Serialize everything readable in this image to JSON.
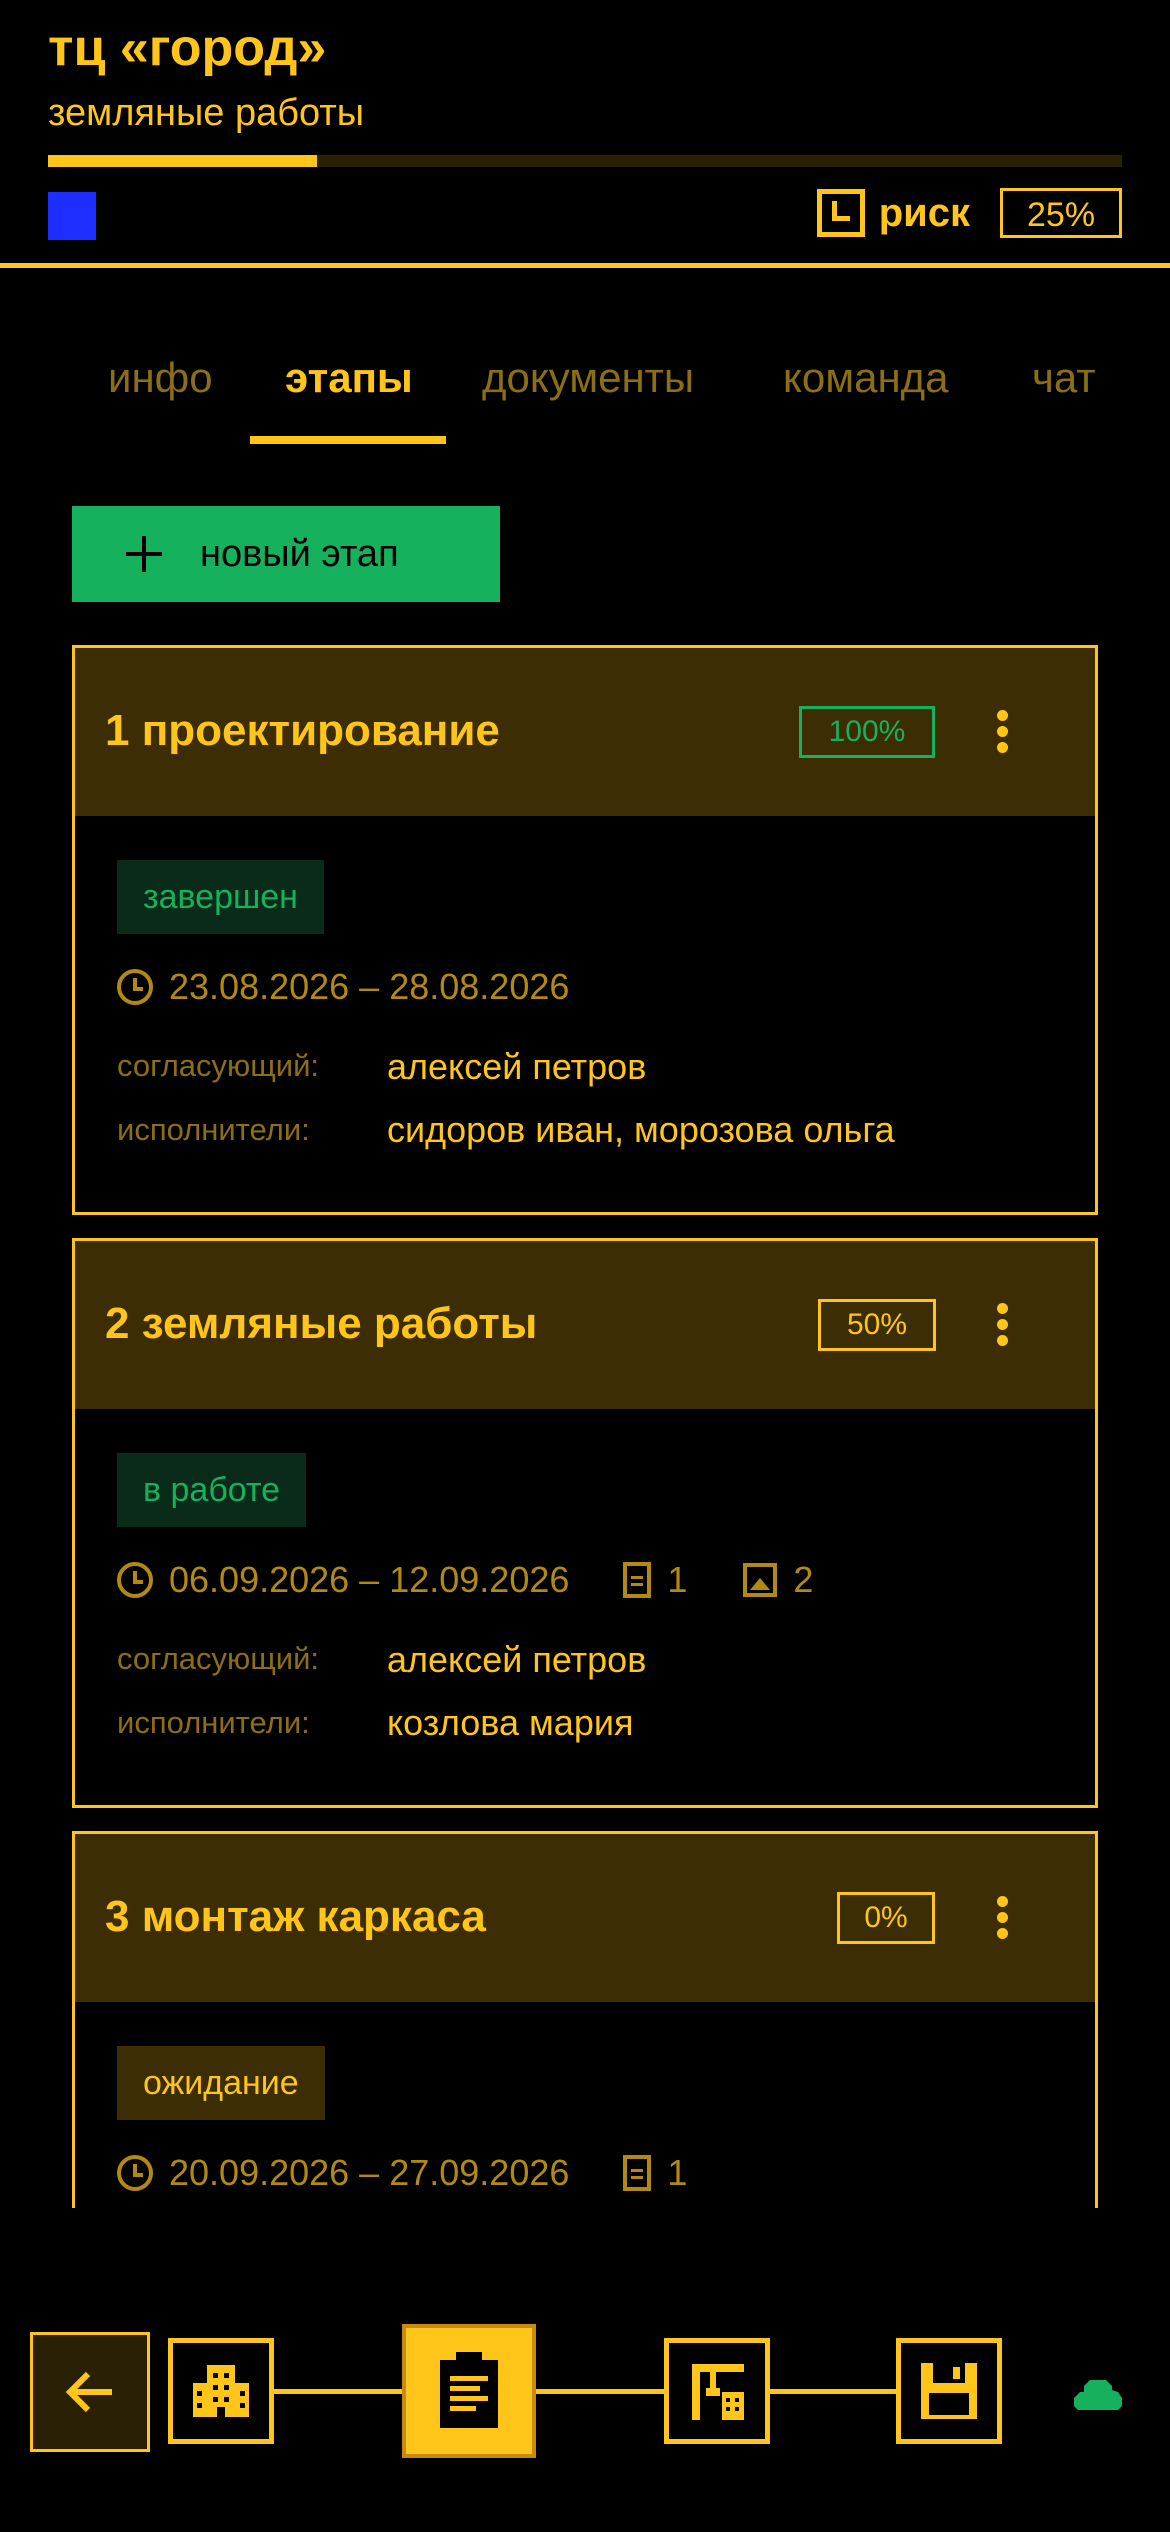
{
  "project": {
    "title": "тц «город»",
    "subtitle": "земляные работы",
    "progress": 0.25,
    "risk_label": "риск",
    "risk_value": "25%"
  },
  "tabs": [
    {
      "label": "инфо",
      "active": false
    },
    {
      "label": "этапы",
      "active": true
    },
    {
      "label": "документы",
      "active": false
    },
    {
      "label": "команда",
      "active": false
    },
    {
      "label": "чат",
      "active": false
    }
  ],
  "new_stage_label": "новый этап",
  "stages": [
    {
      "title": "1 проектирование",
      "percent": "100%",
      "status": "завершен",
      "dates": "23.08.2026 – 28.08.2026",
      "approver_label": "согласующий:",
      "approver": "алексей петров",
      "executors_label": "исполнители:",
      "executors": "сидоров иван, морозова ольга"
    },
    {
      "title": "2 земляные работы",
      "percent": "50%",
      "status": "в работе",
      "dates": "06.09.2026 – 12.09.2026",
      "docs_count": "1",
      "images_count": "2",
      "approver_label": "согласующий:",
      "approver": "алексей петров",
      "executors_label": "исполнители:",
      "executors": "козлова мария"
    },
    {
      "title": "3 монтаж каркаса",
      "percent": "0%",
      "status": "ожидание",
      "dates": "20.09.2026 – 27.09.2026",
      "docs_count": "1"
    }
  ],
  "colors": {
    "accent": "#FFC619",
    "success": "#16B15C",
    "blue": "#1E2EFF",
    "card_header": "#3C2D05"
  },
  "bottom_nav": {
    "steps": [
      "back-arrow-icon",
      "building-icon",
      "clipboard-icon",
      "crane-icon",
      "save-icon"
    ],
    "current_step": "clipboard-icon",
    "status_icon": "cloud-icon"
  }
}
